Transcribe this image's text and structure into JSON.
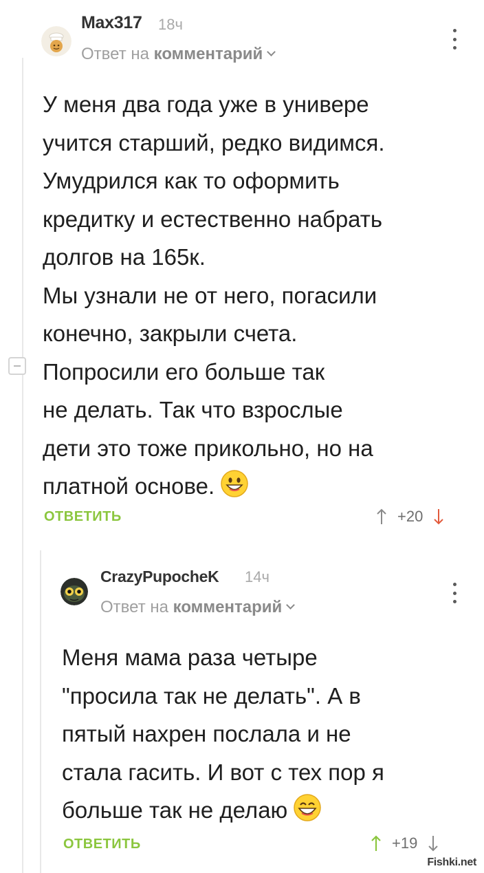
{
  "comment": {
    "username": "Max317",
    "time": "18ч",
    "reply_prefix": "Ответ на",
    "reply_link": "комментарий",
    "lines": [
      "У меня два года уже в универе",
      "учится старший, редко видимся.",
      "Умудрился как то оформить",
      "кредитку и естественно набрать",
      "долгов на 165к.",
      "Мы узнали не от него, погасили",
      "конечно, закрыли счета.",
      "Попросили его больше так",
      "не делать. Так что взрослые",
      "дети это тоже прикольно, но на",
      "платной основе."
    ],
    "emoji": "grinning-face",
    "reply_label": "ОТВЕТИТЬ",
    "rating": "+20",
    "upvote_color": "#8a8a8a",
    "downvote_color": "#e25a3c"
  },
  "reply": {
    "username": "CrazyPupocheK",
    "time": "14ч",
    "reply_prefix": "Ответ на",
    "reply_link": "комментарий",
    "lines": [
      "Меня мама раза четыре",
      "\"просила так не делать\". А в",
      "пятый нахрен послала и не",
      "стала гасить. И вот с тех пор я",
      "больше так не делаю"
    ],
    "emoji": "grinning-face-with-smiling-eyes",
    "reply_label": "ОТВЕТИТЬ",
    "rating": "+19",
    "upvote_color": "#8bc63e",
    "downvote_color": "#8a8a8a"
  },
  "watermark": "Fishki.net",
  "colors": {
    "accent": "#8bc63e",
    "text": "#1f1f1f",
    "muted": "#9f9f9f"
  }
}
